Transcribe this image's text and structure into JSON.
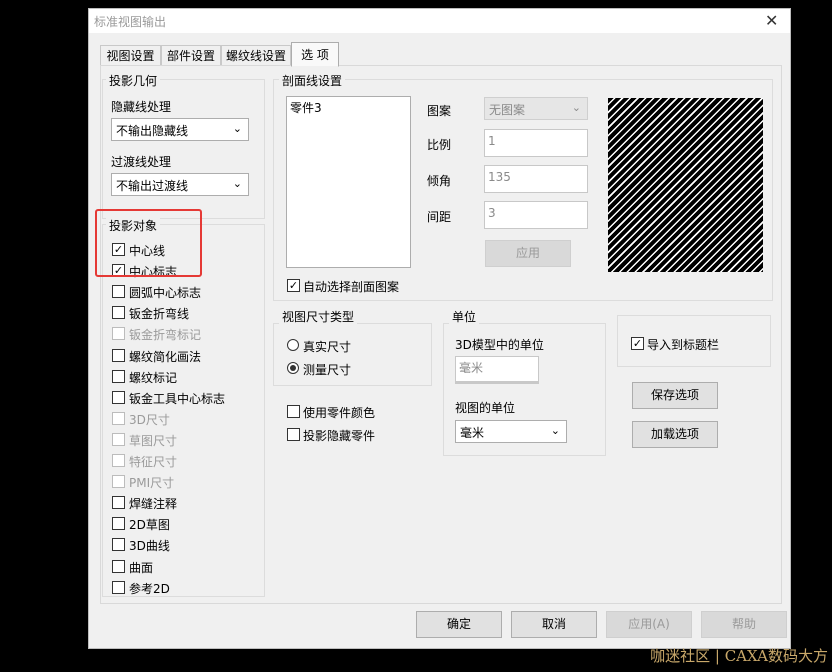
{
  "window": {
    "title": "标准视图输出",
    "close_glyph": "✕"
  },
  "tabs": [
    {
      "label": "视图设置"
    },
    {
      "label": "部件设置"
    },
    {
      "label": "螺纹线设置"
    },
    {
      "label": "选 项"
    }
  ],
  "projection_geometry": {
    "label": "投影几何",
    "hidden_line_label": "隐藏线处理",
    "hidden_line_value": "不输出隐藏线",
    "transition_line_label": "过渡线处理",
    "transition_line_value": "不输出过渡线"
  },
  "projection_objects": {
    "label": "投影对象",
    "items": [
      {
        "label": "中心线",
        "checked": true,
        "enabled": true
      },
      {
        "label": "中心标志",
        "checked": true,
        "enabled": true
      },
      {
        "label": "圆弧中心标志",
        "checked": false,
        "enabled": true
      },
      {
        "label": "钣金折弯线",
        "checked": false,
        "enabled": true
      },
      {
        "label": "钣金折弯标记",
        "checked": false,
        "enabled": false
      },
      {
        "label": "螺纹简化画法",
        "checked": false,
        "enabled": true
      },
      {
        "label": "螺纹标记",
        "checked": false,
        "enabled": true
      },
      {
        "label": "钣金工具中心标志",
        "checked": false,
        "enabled": true
      },
      {
        "label": "3D尺寸",
        "checked": false,
        "enabled": false
      },
      {
        "label": "草图尺寸",
        "checked": false,
        "enabled": false
      },
      {
        "label": "特征尺寸",
        "checked": false,
        "enabled": false
      },
      {
        "label": "PMI尺寸",
        "checked": false,
        "enabled": false
      },
      {
        "label": "焊缝注释",
        "checked": false,
        "enabled": true
      },
      {
        "label": "2D草图",
        "checked": false,
        "enabled": true
      },
      {
        "label": "3D曲线",
        "checked": false,
        "enabled": true
      },
      {
        "label": "曲面",
        "checked": false,
        "enabled": true
      },
      {
        "label": "参考2D",
        "checked": false,
        "enabled": true
      }
    ]
  },
  "section_line": {
    "label": "剖面线设置",
    "list_items": [
      "零件3"
    ],
    "pattern_label": "图案",
    "pattern_value": "无图案",
    "scale_label": "比例",
    "scale_value": "1",
    "angle_label": "倾角",
    "angle_value": "135",
    "spacing_label": "间距",
    "spacing_value": "3",
    "apply_label": "应用",
    "auto_select_label": "自动选择剖面图案",
    "auto_select_checked": true
  },
  "dimension_type": {
    "label": "视图尺寸类型",
    "options": [
      {
        "label": "真实尺寸",
        "selected": false
      },
      {
        "label": "测量尺寸",
        "selected": true
      }
    ]
  },
  "misc_options": [
    {
      "label": "使用零件颜色",
      "checked": false
    },
    {
      "label": "投影隐藏零件",
      "checked": false
    }
  ],
  "unit": {
    "label": "单位",
    "model_unit_label": "3D模型中的单位",
    "model_unit_value": "毫米",
    "view_unit_label": "视图的单位",
    "view_unit_value": "毫米"
  },
  "import_title_bar": {
    "label": "导入到标题栏",
    "checked": true
  },
  "buttons": {
    "save_options": "保存选项",
    "load_options": "加载选项",
    "ok": "确定",
    "cancel": "取消",
    "apply": "应用(A)",
    "help": "帮助"
  },
  "watermark": "咖迷社区 | CAXA数码大方",
  "colors": {
    "highlight_box": "#e53935",
    "watermark": "#c9a86a"
  }
}
